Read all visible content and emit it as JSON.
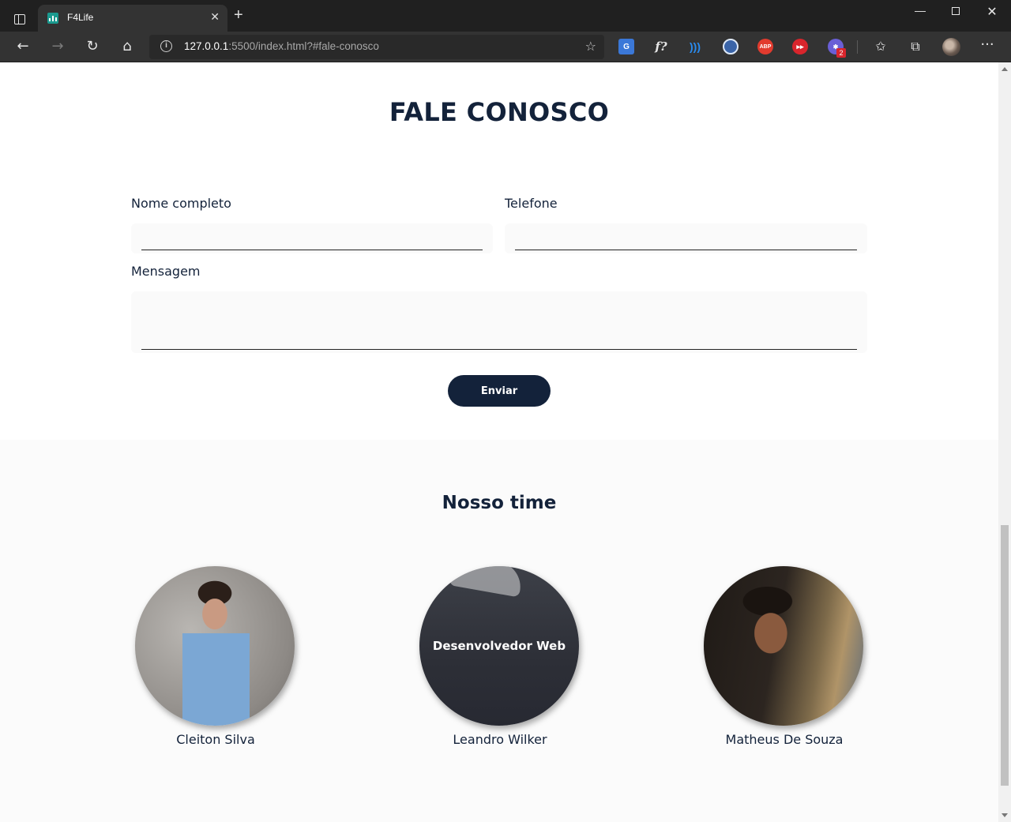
{
  "browser": {
    "tab_title": "F4Life",
    "url_host": "127.0.0.1",
    "url_rest": ":5500/index.html?#fale-conosco",
    "extension_badge": "2"
  },
  "contact": {
    "title": "FALE CONOSCO",
    "name_label": "Nome completo",
    "name_value": "",
    "phone_label": "Telefone",
    "phone_value": "",
    "message_label": "Mensagem",
    "message_value": "",
    "submit_label": "Enviar"
  },
  "team": {
    "title": "Nosso time",
    "members": [
      {
        "name": "Cleiton Silva",
        "overlay": ""
      },
      {
        "name": "Leandro Wilker",
        "overlay": "Desenvolvedor Web"
      },
      {
        "name": "Matheus De Souza",
        "overlay": ""
      }
    ]
  },
  "colors": {
    "brand_navy": "#13223a",
    "team_background": "#fbfbfb",
    "input_background": "#fafafa"
  }
}
